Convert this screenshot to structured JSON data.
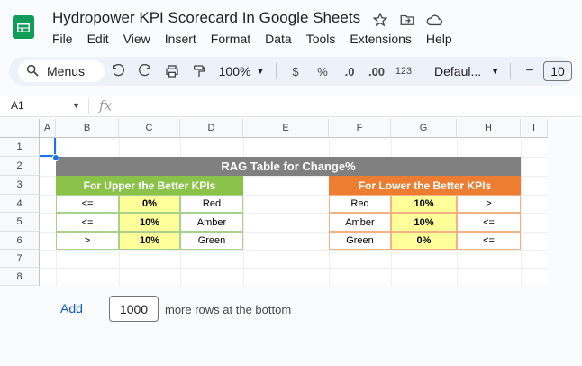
{
  "document": {
    "title": "Hydropower KPI Scorecard In Google Sheets"
  },
  "menu": [
    "File",
    "Edit",
    "View",
    "Insert",
    "Format",
    "Data",
    "Tools",
    "Extensions",
    "Help"
  ],
  "toolbar": {
    "menus_label": "Menus",
    "zoom": "100%",
    "currency": "$",
    "percent": "%",
    "decrease_decimal": ".0",
    "increase_decimal": ".00",
    "number_format": "123",
    "font": "Defaul...",
    "minus": "−",
    "font_size": "10"
  },
  "formula_bar": {
    "cell_ref": "A1",
    "fx": "fx"
  },
  "columns": [
    "A",
    "B",
    "C",
    "D",
    "E",
    "F",
    "G",
    "H",
    "I"
  ],
  "rows": [
    "1",
    "2",
    "3",
    "4",
    "5",
    "6",
    "7",
    "8"
  ],
  "rag_table": {
    "title": "RAG Table for Change%",
    "upper": {
      "header": "For Upper the Better KPIs",
      "rows": [
        {
          "op": "<=",
          "value": "0%",
          "status": "Red"
        },
        {
          "op": "<=",
          "value": "10%",
          "status": "Amber"
        },
        {
          "op": ">",
          "value": "10%",
          "status": "Green"
        }
      ]
    },
    "lower": {
      "header": "For Lower the Better KPIs",
      "rows": [
        {
          "status": "Red",
          "value": "10%",
          "op": ">"
        },
        {
          "status": "Amber",
          "value": "10%",
          "op": "<="
        },
        {
          "status": "Green",
          "value": "0%",
          "op": "<="
        }
      ]
    }
  },
  "footer": {
    "add_label": "Add",
    "rows_value": "1000",
    "suffix": "more rows at the bottom"
  },
  "colors": {
    "gray_header": "#808080",
    "green_header": "#8bc34a",
    "orange_header": "#ed7d31",
    "highlight": "#ffff99",
    "selection": "#1a73e8"
  }
}
